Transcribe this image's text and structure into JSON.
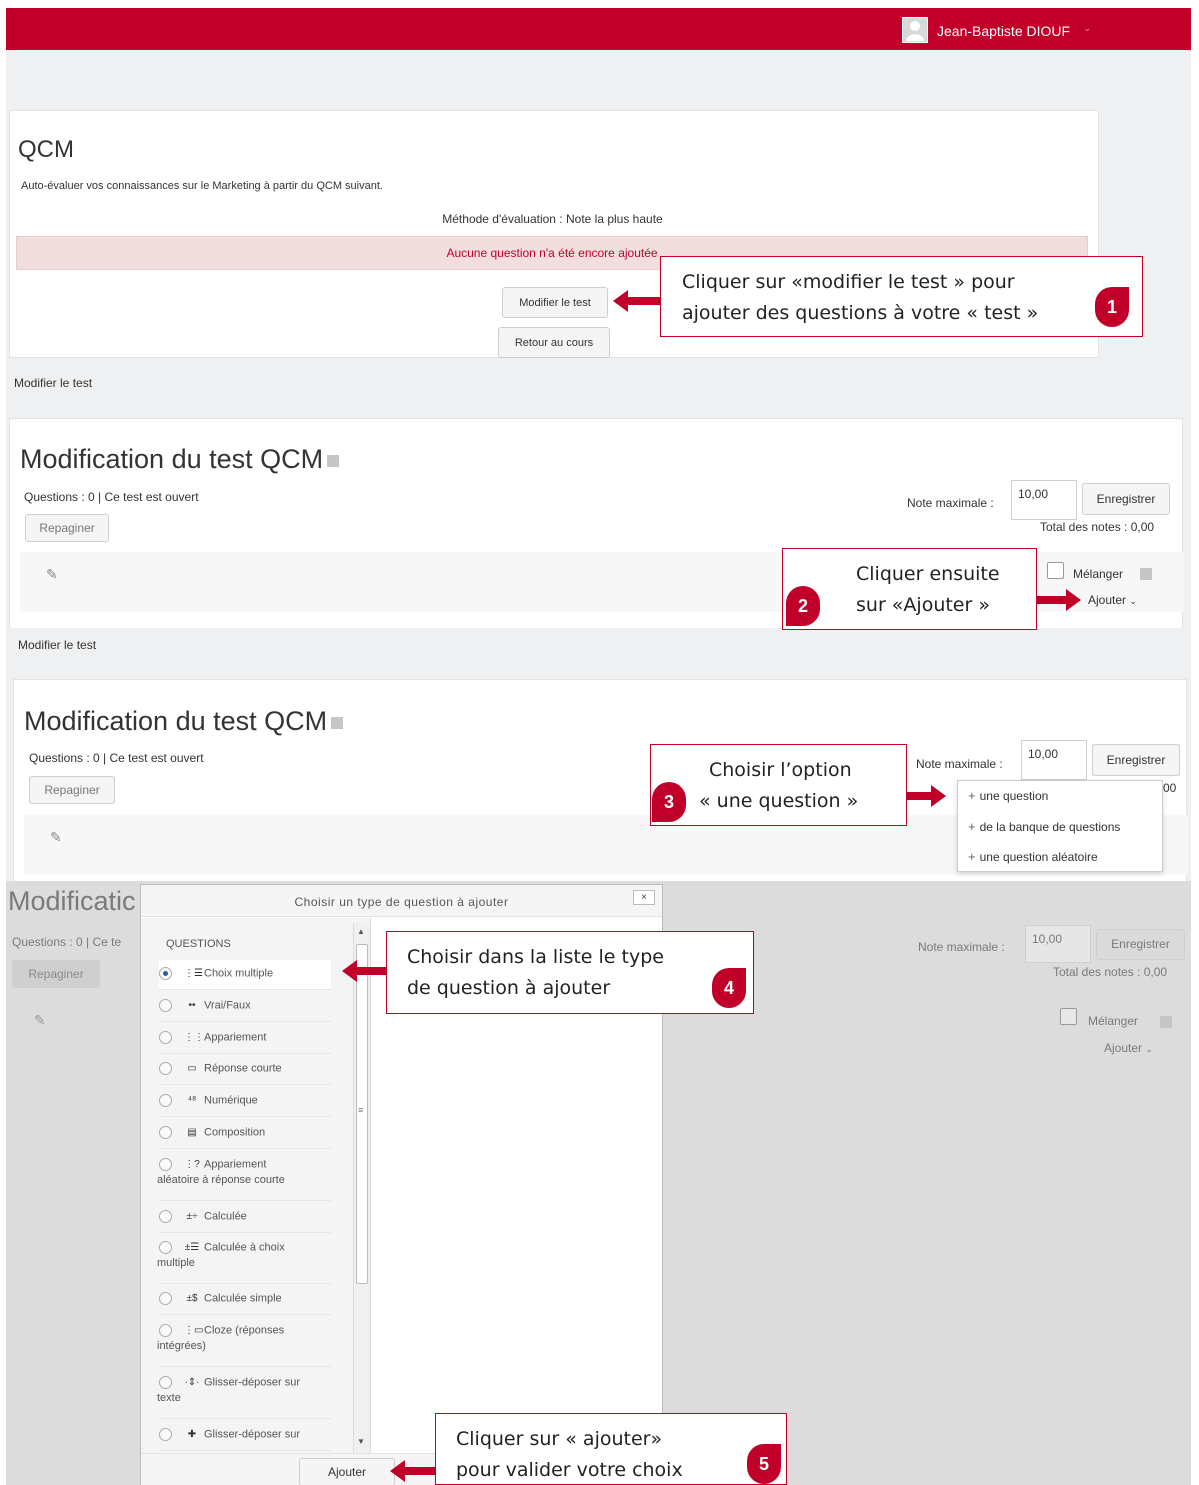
{
  "colors": {
    "brand": "#c1002a",
    "alert_bg": "#f2dede",
    "panel_bg": "#eef0f2",
    "overlay": "#dcdcdc"
  },
  "header": {
    "user_name": "Jean-Baptiste DIOUF",
    "caret": "⌄"
  },
  "quiz": {
    "title": "QCM",
    "description": "Auto-évaluer vos connaissances sur le Marketing à partir du QCM suivant.",
    "grading_method": "Méthode d'évaluation : Note la plus haute",
    "alert": "Aucune question n'a été encore ajoutée",
    "edit_button": "Modifier le test",
    "back_button": "Retour au cours"
  },
  "edit_page": {
    "breadcrumb": "Modifier le test",
    "title": "Modification du test QCM",
    "questions_info": "Questions : 0 | Ce test est ouvert",
    "repaginate": "Repaginer",
    "max_grade_label": "Note maximale :",
    "max_grade_value": "10,00",
    "save_button": "Enregistrer",
    "total_grades": "Total des notes : 0,00",
    "total_grades_partial": "00",
    "shuffle_label": "Mélanger",
    "add_menu": "Ajouter",
    "add_caret": "⌄"
  },
  "add_dropdown": {
    "items": [
      "une question",
      "de la banque de questions",
      "une question aléatoire"
    ]
  },
  "dialog": {
    "title_partial": "Modificatic",
    "questions_info_partial": "Questions : 0 | Ce te",
    "title": "Choisir un type de question à ajouter",
    "close": "×",
    "section_header": "QUESTIONS",
    "add_button": "Ajouter",
    "options": [
      {
        "label": "Choix multiple",
        "selected": true,
        "icon": "multichoice-icon",
        "glyph": "⋮☰"
      },
      {
        "label": "Vrai/Faux",
        "selected": false,
        "icon": "truefalse-icon",
        "glyph": "••"
      },
      {
        "label": "Appariement",
        "selected": false,
        "icon": "match-icon",
        "glyph": "⋮⋮"
      },
      {
        "label": "Réponse courte",
        "selected": false,
        "icon": "shortanswer-icon",
        "glyph": "▭"
      },
      {
        "label": "Numérique",
        "selected": false,
        "icon": "numerical-icon",
        "glyph": "⁴⁸"
      },
      {
        "label": "Composition",
        "selected": false,
        "icon": "essay-icon",
        "glyph": "▤"
      },
      {
        "label": "Appariement",
        "label2": "aléatoire à réponse courte",
        "selected": false,
        "icon": "randomsamatch-icon",
        "glyph": "⋮?"
      },
      {
        "label": "Calculée",
        "selected": false,
        "icon": "calculated-icon",
        "glyph": "±÷"
      },
      {
        "label": "Calculée à choix",
        "label2": "multiple",
        "selected": false,
        "icon": "calculatedmulti-icon",
        "glyph": "±☰"
      },
      {
        "label": "Calculée simple",
        "selected": false,
        "icon": "calculatedsimple-icon",
        "glyph": "±$"
      },
      {
        "label": "Cloze (réponses",
        "label2": "intégrées)",
        "selected": false,
        "icon": "cloze-icon",
        "glyph": "⋮▭"
      },
      {
        "label": "Glisser-déposer sur",
        "label2": "texte",
        "selected": false,
        "icon": "ddwtos-icon",
        "glyph": "·⇕·"
      },
      {
        "label": "Glisser-déposer sur",
        "selected": false,
        "icon": "ddimage-icon",
        "glyph": "✚"
      }
    ]
  },
  "annotations": [
    {
      "number": "1",
      "lines": [
        "Cliquer sur «modifier le test » pour",
        "ajouter des questions à votre « test »"
      ]
    },
    {
      "number": "2",
      "lines": [
        "Cliquer ensuite",
        "sur «Ajouter »"
      ]
    },
    {
      "number": "3",
      "lines": [
        "Choisir l’option",
        "« une question »"
      ]
    },
    {
      "number": "4",
      "lines": [
        "Choisir dans la liste le type",
        "de question à ajouter"
      ]
    },
    {
      "number": "5",
      "lines": [
        "Cliquer sur « ajouter»",
        "pour valider votre choix"
      ]
    }
  ]
}
